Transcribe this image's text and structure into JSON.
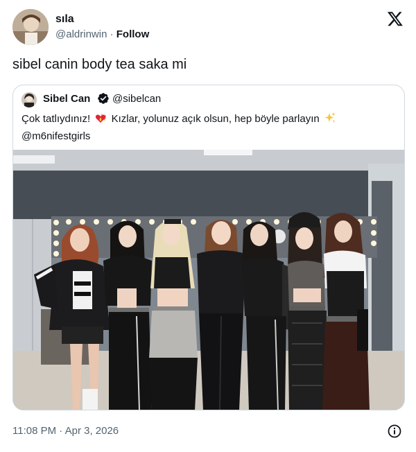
{
  "tweet": {
    "author": {
      "name": "sıla",
      "handle": "@aldrinwin",
      "separator": "·",
      "follow_label": "Follow"
    },
    "text": "sibel canin body tea saka mi",
    "timestamp": "11:08 PM · Apr 3, 2026"
  },
  "quoted": {
    "author": {
      "name": "Sibel Can",
      "handle": "@sibelcan"
    },
    "text_part1": "Çok tatlıydınız!",
    "text_part2": "Kızlar, yolunuz açık olsun, hep böyle parlayın",
    "mention": "@m6nifestgirls"
  },
  "icons": {
    "logo": "x-logo-icon",
    "verified": "verified-badge-icon",
    "info": "info-icon",
    "emoji1": "heart-on-fire-emoji",
    "emoji2": "sparkles-emoji"
  },
  "colors": {
    "text": "#0f1419",
    "secondary": "#536471",
    "border": "#cfd9de"
  }
}
